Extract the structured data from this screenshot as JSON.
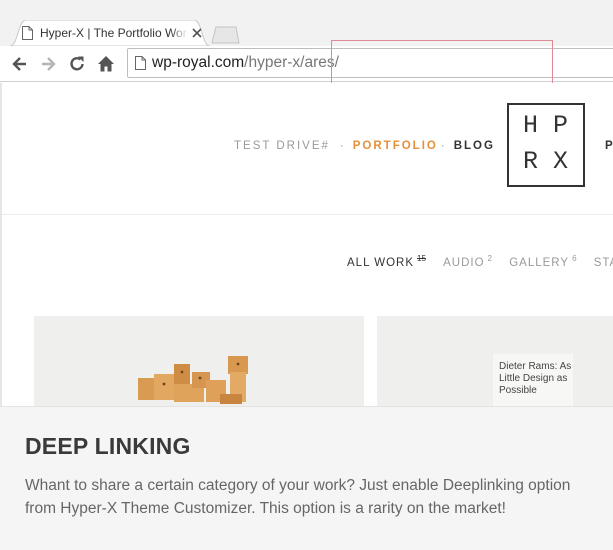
{
  "browser": {
    "tab_title": "Hyper-X | The Portfolio WordPress Theme",
    "url_host": "wp-royal.com",
    "url_path": "/hyper-x/ares/"
  },
  "site": {
    "nav": {
      "test_drive": "TEST DRIVE#",
      "portfolio": "PORTFOLIO",
      "blog": "BLOG",
      "separator": "·",
      "cut_item": "P"
    },
    "logo": {
      "l1": "H",
      "l2": "P",
      "l3": "R",
      "l4": "X"
    },
    "filters": [
      {
        "label": "ALL WORK",
        "count": "15"
      },
      {
        "label": "AUDIO",
        "count": "2"
      },
      {
        "label": "GALLERY",
        "count": "6"
      },
      {
        "label": "STA",
        "count": ""
      }
    ],
    "card2_text": "Dieter Rams: As Little Design as Possible"
  },
  "caption": {
    "title": "DEEP LINKING",
    "text": "Whant to share a certain category of your work? Just enable Deeplinking option from Hyper-X Theme Customizer. This option is a rarity on the market!"
  },
  "colors": {
    "accent": "#e5903b",
    "highlight": "#e08a95"
  }
}
